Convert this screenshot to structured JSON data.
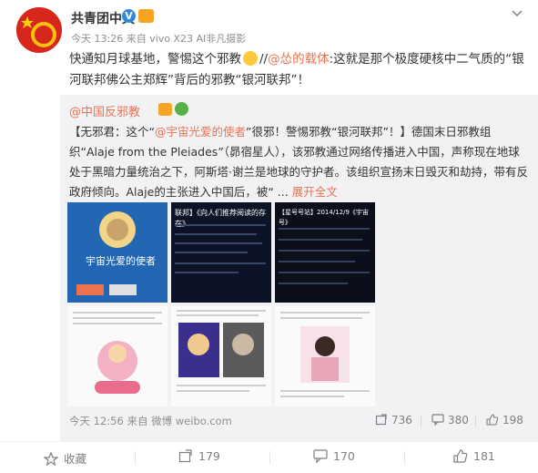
{
  "author": {
    "name": "共青团中央",
    "verified_badge": "V",
    "meta": "今天 13:26 来自 vivo X23 AI非凡摄影"
  },
  "post": {
    "text_1": "快通知月球基地，警惕这个邪教",
    "separator": "//",
    "mention": "@怂的载体",
    "text_2": ":这就是那个极度硬核中二气质的“银河联邦佛公主郑辉”背后的邪教“银河联邦”！"
  },
  "repost": {
    "author": "@中国反邪教",
    "verified_badge": "V",
    "text_prefix": "【无邪君：这个“",
    "link": "@宇宙光爱的使者",
    "text_body": "”很邪！警惕邪教“银河联邦”！】德国末日邪教组织“Alaje from the Pleiades”（昴宿星人），该邪教通过网络传播进入中国，声称现在地球处于黑暗力量统治之下，阿斯塔·谢兰是地球的守护者。该组织宣扬末日毁灭和劫持，带有反政府倾向。Alaje的主张进入中国后，被“ ...",
    "expand": "展开全文",
    "images": [
      {
        "caption": "宇宙光爱的使者"
      },
      {
        "caption": "联邦】《向人们推荐阅读的存在》"
      },
      {
        "caption": "【星号号站】2014/12/9《宇宙号》"
      },
      {
        "caption": ""
      },
      {
        "caption": ""
      },
      {
        "caption": ""
      }
    ],
    "footer_time": "今天 12:56 来自 微博 weibo.com",
    "stats": {
      "reposts": "736",
      "comments": "380",
      "likes": "198"
    }
  },
  "actions": {
    "collect": "收藏",
    "reposts": "179",
    "comments": "170",
    "likes": "181"
  },
  "colors": {
    "accent": "#eb7350",
    "verified": "#2f88e0",
    "repost_bg": "#f2f2f5"
  }
}
